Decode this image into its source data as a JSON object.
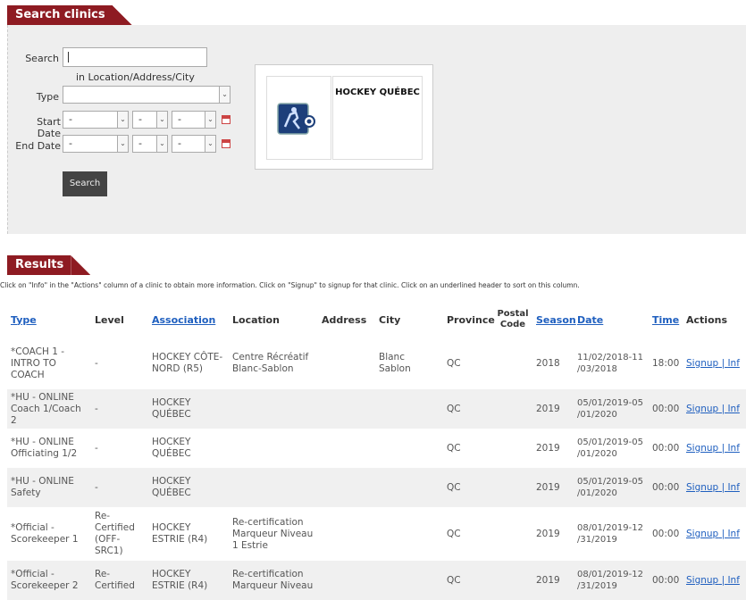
{
  "search_section": {
    "title": "Search clinics",
    "search_label": "Search",
    "search_value": "",
    "search_hint": "in Location/Address/City",
    "type_label": "Type",
    "type_value": "",
    "start_date_label": "Start Date",
    "end_date_label": "End Date",
    "date_placeholder": "-",
    "search_button": "Search",
    "org_name": "HOCKEY QUÉBEC"
  },
  "results_section": {
    "title": "Results",
    "hint": "Click on \"Info\" in the \"Actions\" column of a clinic to obtain more information. Click on \"Signup\" to signup for that clinic. Click on an underlined header to sort on this column.",
    "columns": {
      "type": "Type",
      "level": "Level",
      "association": "Association",
      "location": "Location",
      "address": "Address",
      "city": "City",
      "province": "Province",
      "postal": "Postal Code",
      "season": "Season",
      "date": "Date",
      "time": "Time",
      "actions": "Actions"
    },
    "signup_label": "Signup",
    "info_label": "Inf",
    "rows": [
      {
        "type": "*COACH 1 - INTRO TO COACH",
        "level": "-",
        "association": "HOCKEY CÔTE-NORD (R5)",
        "location": "Centre Récréatif Blanc-Sablon",
        "address": "",
        "city": "Blanc Sablon",
        "province": "QC",
        "postal": "",
        "season": "2018",
        "date": "11/02/2018-11 /03/2018",
        "time": "18:00"
      },
      {
        "type": "*HU - ONLINE Coach 1/Coach 2",
        "level": "-",
        "association": "HOCKEY QUÉBEC",
        "location": "",
        "address": "",
        "city": "",
        "province": "QC",
        "postal": "",
        "season": "2019",
        "date": "05/01/2019-05 /01/2020",
        "time": "00:00"
      },
      {
        "type": "*HU - ONLINE Officiating 1/2",
        "level": "-",
        "association": "HOCKEY QUÉBEC",
        "location": "",
        "address": "",
        "city": "",
        "province": "QC",
        "postal": "",
        "season": "2019",
        "date": "05/01/2019-05 /01/2020",
        "time": "00:00"
      },
      {
        "type": "*HU - ONLINE Safety",
        "level": "-",
        "association": "HOCKEY QUÉBEC",
        "location": "",
        "address": "",
        "city": "",
        "province": "QC",
        "postal": "",
        "season": "2019",
        "date": "05/01/2019-05 /01/2020",
        "time": "00:00"
      },
      {
        "type": "*Official - Scorekeeper 1",
        "level": "Re-Certified (OFF-SRC1)",
        "association": "HOCKEY ESTRIE (R4)",
        "location": "Re-certification Marqueur Niveau 1 Estrie",
        "address": "",
        "city": "",
        "province": "QC",
        "postal": "",
        "season": "2019",
        "date": "08/01/2019-12 /31/2019",
        "time": "00:00"
      },
      {
        "type": "*Official - Scorekeeper 2",
        "level": "Re-Certified",
        "association": "HOCKEY ESTRIE (R4)",
        "location": "Re-certification Marqueur Niveau",
        "address": "",
        "city": "",
        "province": "QC",
        "postal": "",
        "season": "2019",
        "date": "08/01/2019-12 /31/2019",
        "time": "00:00"
      }
    ]
  }
}
